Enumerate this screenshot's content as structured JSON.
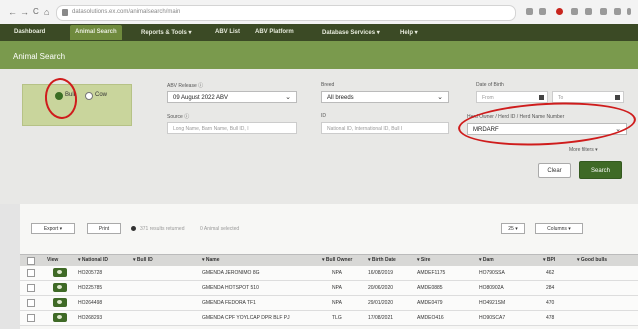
{
  "browser": {
    "nav_back": "←",
    "nav_forward": "→",
    "nav_reload": "C",
    "nav_home": "⌂",
    "url": "datasolutions.ex.com/animalsearch/main"
  },
  "main_nav": {
    "items": [
      {
        "label": "Dashboard",
        "active": false
      },
      {
        "label": "Animal Search",
        "active": true
      },
      {
        "label": "Reports & Tools  ▾",
        "active": false
      },
      {
        "label": "ABV List",
        "active": false
      },
      {
        "label": "ABV Platform",
        "active": false
      },
      {
        "label": "Database Services  ▾",
        "active": false
      },
      {
        "label": "Help  ▾",
        "active": false
      }
    ]
  },
  "page": {
    "title": "Animal Search"
  },
  "filters": {
    "sex_options": [
      {
        "label": "Bull",
        "selected": true
      },
      {
        "label": "Cow",
        "selected": false
      }
    ],
    "abv_release_label": "ABV Release ⓘ",
    "abv_release_value": "09 August 2022 ABV",
    "breed_label": "Breed",
    "breed_value": "All breeds",
    "date_of_birth_label": "Date of Birth",
    "dob_from_placeholder": "From",
    "dob_to_placeholder": "To",
    "source_label": "Source ⓘ",
    "source_placeholder": "Long Name, Barn Name, Bull ID, I",
    "id_label": "ID",
    "id_placeholder": "National ID, International ID, Bull I",
    "herd_owner_label": "Herd Owner / Herd ID / Herd Name Number",
    "herd_owner_value": "MRDARF",
    "more_filters": "More filters  ▾",
    "clear_button": "Clear",
    "search_button": "Search"
  },
  "toolbar": {
    "export_label": "Export  ▾",
    "print_label": "Print",
    "results_selected": "371 results returned",
    "animals_selected": "0 Animal selected",
    "per_page": "25  ▾",
    "columns": "Columns  ▾"
  },
  "table": {
    "headers": [
      "View",
      "▾ National ID",
      "▾ Bull ID",
      "▾ Name",
      "▾ Bull Owner",
      "▾ Birth Date",
      "▾ Sire",
      "▾ Dam",
      "▾ BPI",
      "▾ Good bulls"
    ],
    "rows": [
      [
        "HO205728",
        "",
        "GMENDA JERONIMO 8G",
        "NPA",
        "16/08/2019",
        "AMDEF1175",
        "HO790SSA",
        "462"
      ],
      [
        "HO225785",
        "",
        "GMENDA HOTSPOT 510",
        "NPA",
        "20/06/2020",
        "AMDE0885",
        "HO80902A",
        "284"
      ],
      [
        "HO264498",
        "",
        "GMENDA FEDORA TF1",
        "NPA",
        "29/01/2020",
        "AMDE0479",
        "HO4921SM",
        "470"
      ],
      [
        "HO268293",
        "",
        "GMENDA CPF YOYLCAP DPR BLF PJ",
        "TLG",
        "17/08/2021",
        "AMDEO416",
        "HO90SCA7",
        "478"
      ]
    ]
  }
}
